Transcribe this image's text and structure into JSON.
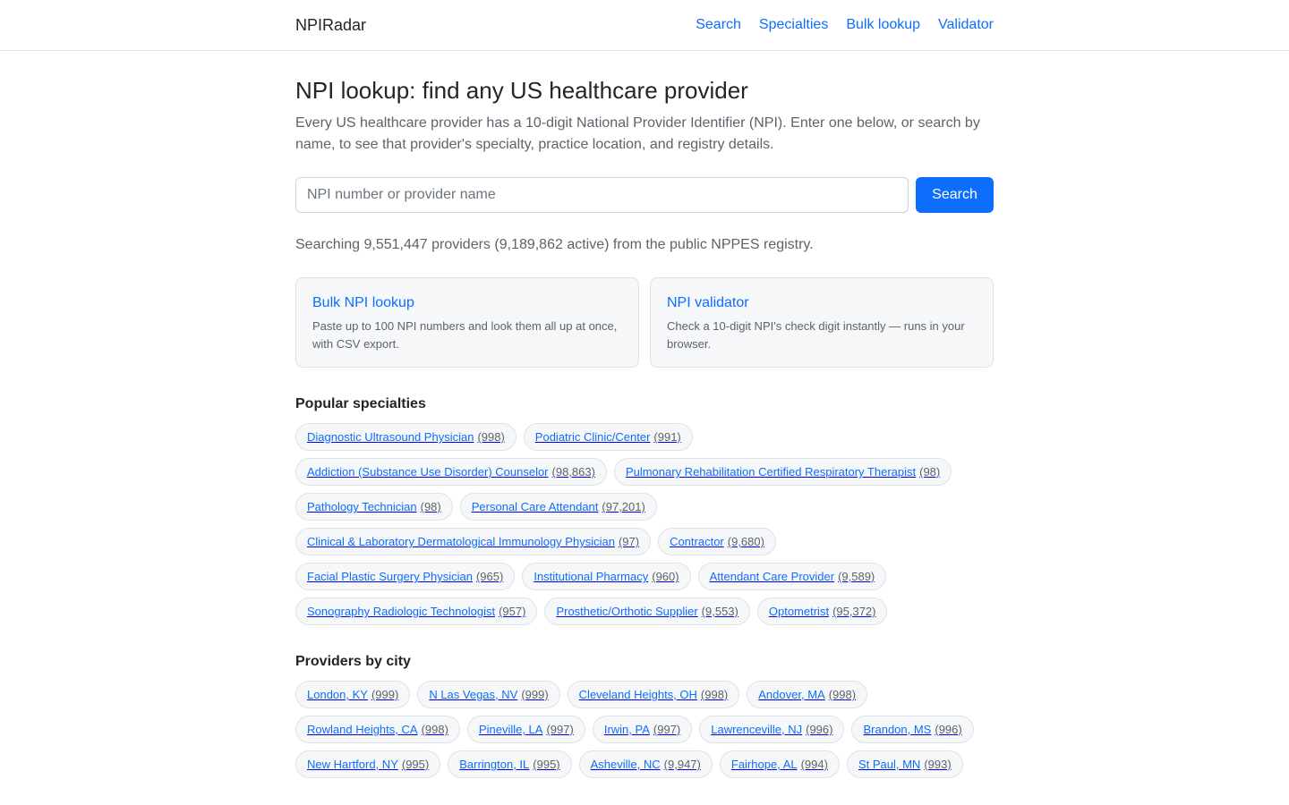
{
  "header": {
    "brand": "NPIRadar",
    "nav": [
      {
        "label": "Search"
      },
      {
        "label": "Specialties"
      },
      {
        "label": "Bulk lookup"
      },
      {
        "label": "Validator"
      }
    ]
  },
  "hero": {
    "title": "NPI lookup: find any US healthcare provider",
    "description": "Every US healthcare provider has a 10-digit National Provider Identifier (NPI). Enter one below, or search by name, to see that provider's specialty, practice location, and registry details."
  },
  "search": {
    "placeholder": "NPI number or provider name",
    "value": "",
    "button_label": "Search"
  },
  "stats": "Searching 9,551,447 providers (9,189,862 active) from the public NPPES registry.",
  "cards": [
    {
      "title": "Bulk NPI lookup",
      "description": "Paste up to 100 NPI numbers and look them all up at once, with CSV export."
    },
    {
      "title": "NPI validator",
      "description": "Check a 10-digit NPI's check digit instantly — runs in your browser."
    }
  ],
  "specialties": {
    "title": "Popular specialties",
    "items": [
      {
        "label": "Diagnostic Ultrasound Physician",
        "count": "(998)"
      },
      {
        "label": "Podiatric Clinic/Center",
        "count": "(991)"
      },
      {
        "label": "Addiction (Substance Use Disorder) Counselor",
        "count": "(98,863)"
      },
      {
        "label": "Pulmonary Rehabilitation Certified Respiratory Therapist",
        "count": "(98)"
      },
      {
        "label": "Pathology Technician",
        "count": "(98)"
      },
      {
        "label": "Personal Care Attendant",
        "count": "(97,201)"
      },
      {
        "label": "Clinical & Laboratory Dermatological Immunology Physician",
        "count": "(97)"
      },
      {
        "label": "Contractor",
        "count": "(9,680)"
      },
      {
        "label": "Facial Plastic Surgery Physician",
        "count": "(965)"
      },
      {
        "label": "Institutional Pharmacy",
        "count": "(960)"
      },
      {
        "label": "Attendant Care Provider",
        "count": "(9,589)"
      },
      {
        "label": "Sonography Radiologic Technologist",
        "count": "(957)"
      },
      {
        "label": "Prosthetic/Orthotic Supplier",
        "count": "(9,553)"
      },
      {
        "label": "Optometrist",
        "count": "(95,372)"
      }
    ]
  },
  "cities": {
    "title": "Providers by city",
    "items": [
      {
        "label": "London, KY",
        "count": "(999)"
      },
      {
        "label": "N Las Vegas, NV",
        "count": "(999)"
      },
      {
        "label": "Cleveland Heights, OH",
        "count": "(998)"
      },
      {
        "label": "Andover, MA",
        "count": "(998)"
      },
      {
        "label": "Rowland Heights, CA",
        "count": "(998)"
      },
      {
        "label": "Pineville, LA",
        "count": "(997)"
      },
      {
        "label": "Irwin, PA",
        "count": "(997)"
      },
      {
        "label": "Lawrenceville, NJ",
        "count": "(996)"
      },
      {
        "label": "Brandon, MS",
        "count": "(996)"
      },
      {
        "label": "New Hartford, NY",
        "count": "(995)"
      },
      {
        "label": "Barrington, IL",
        "count": "(995)"
      },
      {
        "label": "Asheville, NC",
        "count": "(9,947)"
      },
      {
        "label": "Fairhope, AL",
        "count": "(994)"
      },
      {
        "label": "St Paul, MN",
        "count": "(993)"
      }
    ]
  },
  "colors": {
    "link": "#0d6efd",
    "primary_button": "#0d6efd",
    "muted_text": "#5c636a",
    "card_background": "#f6f7f9",
    "border": "#dee2e6"
  }
}
